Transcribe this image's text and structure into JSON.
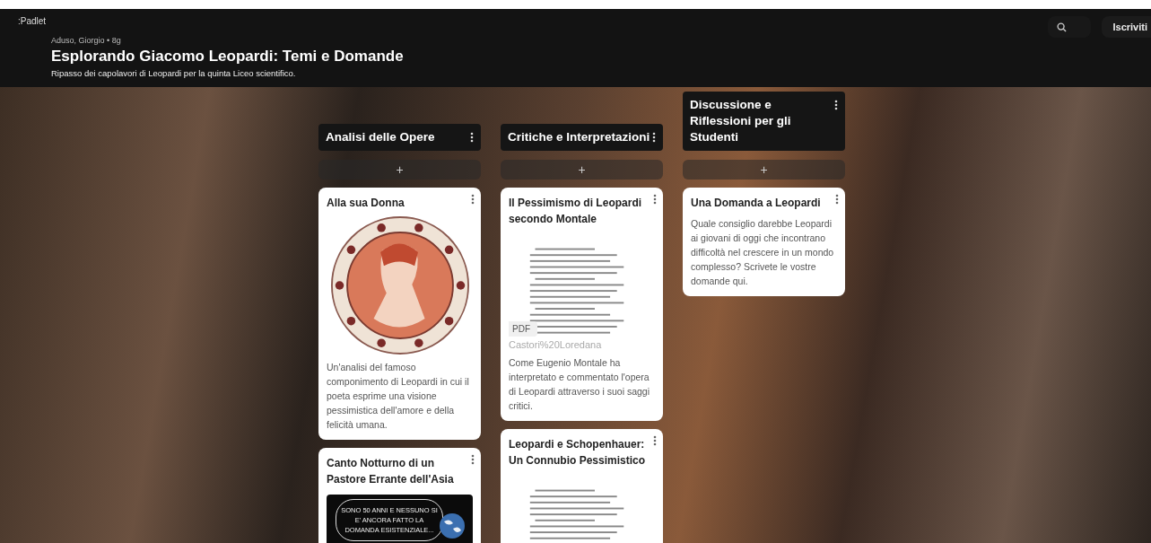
{
  "app": {
    "logo": ":Padlet",
    "signup_button": "Iscriviti"
  },
  "board": {
    "meta": "Aduso, Giorgio • 8g",
    "title": "Esplorando Giacomo Leopardi: Temi e Domande",
    "description": "Ripasso dei capolavori di Leopardi per la quinta Liceo scientifico."
  },
  "columns": [
    {
      "title": "Analisi delle Opere",
      "add_label": "+",
      "posts": [
        {
          "kind": "image",
          "title": "Alla sua Donna",
          "body": "Un'analisi del famoso componimento di Leopardi in cui il poeta esprime una visione pessimistica dell'amore e della felicità umana."
        },
        {
          "kind": "comic",
          "title": "Canto Notturno di un Pastore Errante dell'Asia",
          "caption": "SONO 50 ANNI E NESSUNO SI E' ANCORA FATTO LA DOMANDA ESISTENZIALE..."
        }
      ]
    },
    {
      "title": "Critiche e Interpretazioni",
      "add_label": "+",
      "posts": [
        {
          "kind": "pdf",
          "title": "Il Pessimismo di Leopardi secondo Montale",
          "file_type": "PDF",
          "file_name": "Castori%20Loredana",
          "body": "Come Eugenio Montale ha interpretato e commentato l'opera di Leopardi attraverso i suoi saggi critici."
        },
        {
          "kind": "pdf",
          "title": "Leopardi e Schopenhauer: Un Connubio Pessimistico"
        }
      ]
    },
    {
      "title": "Discussione e Riflessioni per gli Studenti",
      "add_label": "+",
      "posts": [
        {
          "kind": "text",
          "title": "Una Domanda a Leopardi",
          "body": "Quale consiglio darebbe Leopardi ai giovani di oggi che incontrano difficoltà nel crescere in un mondo complesso? Scrivete le vostre domande qui."
        }
      ]
    }
  ]
}
